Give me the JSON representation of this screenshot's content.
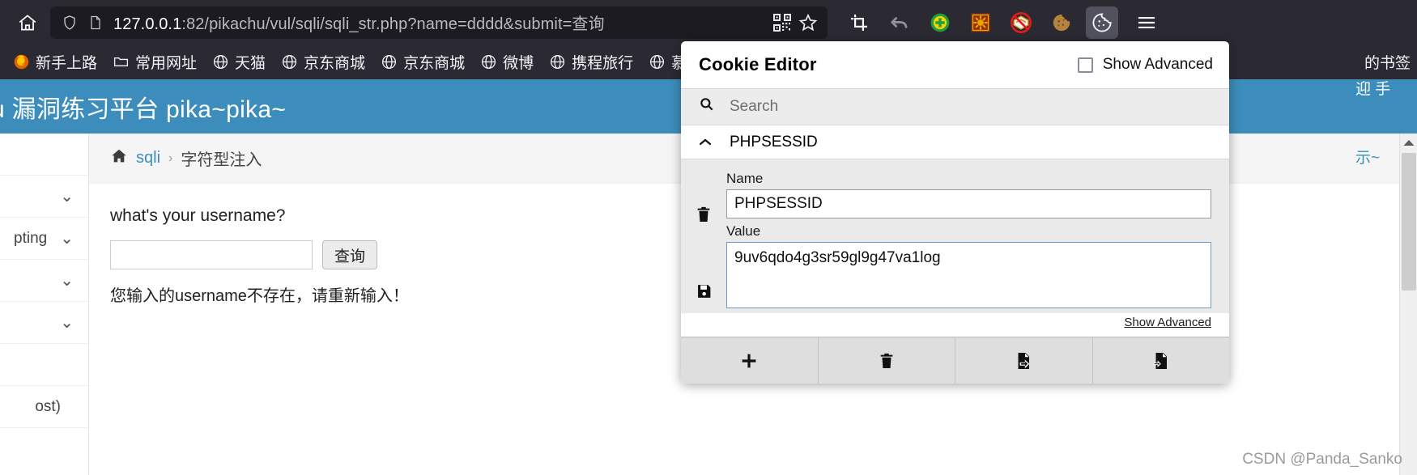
{
  "browser": {
    "home_icon": "home-icon",
    "url": {
      "host": "127.0.0.1",
      "path": ":82/pikachu/vul/sqli/sqli_str.php?name=dddd&submit=查询",
      "full": "127.0.0.1:82/pikachu/vul/sqli/sqli_str.php?name=dddd&submit=查询"
    },
    "urlbar_icons": [
      "shield-icon",
      "page-icon"
    ],
    "urlbar_right_icons": [
      "qrcode-icon",
      "bookmark-star-icon"
    ],
    "toolbar_extensions": [
      {
        "name": "screenshot-crop-icon",
        "glyph": "⛶"
      },
      {
        "name": "undo-arrow-icon",
        "glyph": "↩"
      },
      {
        "name": "green-plus-extension-icon",
        "glyph": "●"
      },
      {
        "name": "orange-sun-extension-icon",
        "glyph": "☀"
      },
      {
        "name": "noscript-blocked-icon",
        "glyph": "🚫"
      },
      {
        "name": "cookie-crumb-icon",
        "glyph": "🍪"
      },
      {
        "name": "cookie-editor-icon",
        "glyph": "🍪"
      }
    ],
    "menu_icon": "hamburger-menu-icon",
    "bookmarks": [
      {
        "label": "新手上路",
        "icon": "firefox-icon"
      },
      {
        "label": "常用网址",
        "icon": "folder-icon"
      },
      {
        "label": "天猫",
        "icon": "globe-icon"
      },
      {
        "label": "京东商城",
        "icon": "globe-icon"
      },
      {
        "label": "京东商城",
        "icon": "globe-icon"
      },
      {
        "label": "微博",
        "icon": "globe-icon"
      },
      {
        "label": "携程旅行",
        "icon": "globe-icon"
      },
      {
        "label": "慕课网-程序员的",
        "icon": "globe-icon"
      }
    ],
    "bookmarks_overflow": "的书签"
  },
  "page": {
    "header_title": "hu 漏洞练习平台 pika~pika~",
    "sidebar": [
      {
        "label": "",
        "chevron": "⌄"
      },
      {
        "label": "pting",
        "chevron": "⌄"
      },
      {
        "label": "",
        "chevron": "⌄"
      },
      {
        "label": "",
        "chevron": "⌄"
      },
      {
        "label": "",
        "chevron": ""
      },
      {
        "label": "ost)",
        "chevron": ""
      }
    ],
    "breadcrumb": {
      "home_icon": "home-icon",
      "link": "sqli",
      "separator": "›",
      "current": "字符型注入"
    },
    "form": {
      "question": "what's your username?",
      "input_value": "",
      "input_placeholder": "",
      "submit_label": "查询",
      "result_message": "您输入的username不存在，请重新输入！"
    },
    "right_strip": {
      "blue_text": "迎 手",
      "crumb_text": "示~"
    },
    "scrollbar": {
      "up_arrow": "⌃"
    },
    "watermark": "CSDN @Panda_Sanko"
  },
  "cookie_editor": {
    "title": "Cookie Editor",
    "show_advanced_checkbox_label": "Show Advanced",
    "search_placeholder": "Search",
    "search_icon": "search-icon",
    "cookie_row": {
      "caret": "⌃",
      "name": "PHPSESSID"
    },
    "fields": {
      "name_label": "Name",
      "name_value": "PHPSESSID",
      "value_label": "Value",
      "value_value": "9uv6qdo4g3sr59gl9g47va1log"
    },
    "side_buttons": [
      {
        "name": "delete-cookie-icon",
        "glyph": "🗑"
      },
      {
        "name": "save-cookie-icon",
        "glyph": "💾"
      }
    ],
    "show_advanced_link": "Show Advanced",
    "footer_buttons": [
      {
        "name": "add-cookie-button",
        "glyph": "+"
      },
      {
        "name": "delete-all-cookies-button",
        "glyph": "🗑"
      },
      {
        "name": "import-cookies-button",
        "glyph": "⇥"
      },
      {
        "name": "export-cookies-button",
        "glyph": "⇤"
      }
    ]
  }
}
